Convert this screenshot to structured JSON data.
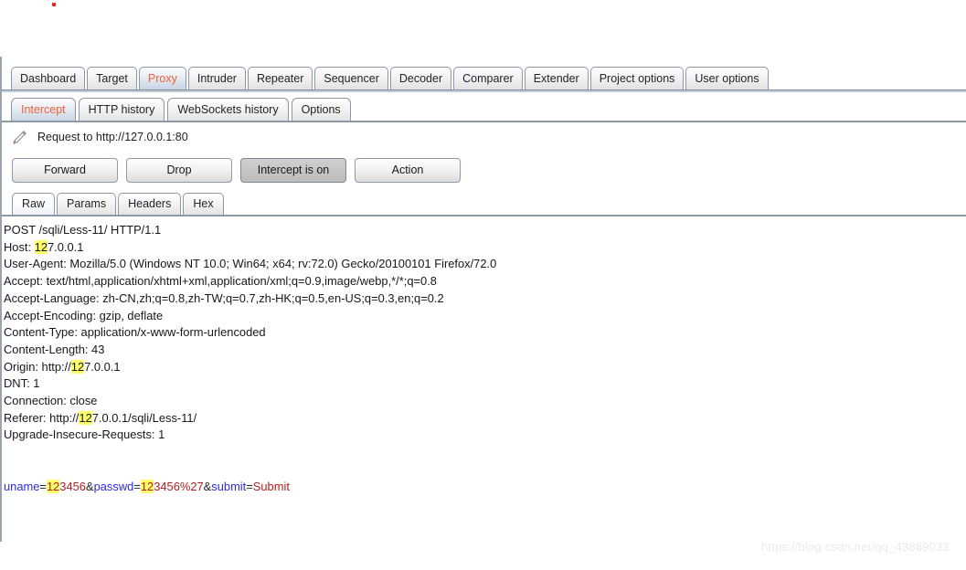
{
  "main_tabs": [
    {
      "label": "Dashboard",
      "selected": false
    },
    {
      "label": "Target",
      "selected": false
    },
    {
      "label": "Proxy",
      "selected": true
    },
    {
      "label": "Intruder",
      "selected": false
    },
    {
      "label": "Repeater",
      "selected": false
    },
    {
      "label": "Sequencer",
      "selected": false
    },
    {
      "label": "Decoder",
      "selected": false
    },
    {
      "label": "Comparer",
      "selected": false
    },
    {
      "label": "Extender",
      "selected": false
    },
    {
      "label": "Project options",
      "selected": false
    },
    {
      "label": "User options",
      "selected": false
    }
  ],
  "proxy_tabs": [
    {
      "label": "Intercept",
      "selected": true
    },
    {
      "label": "HTTP history",
      "selected": false
    },
    {
      "label": "WebSockets history",
      "selected": false
    },
    {
      "label": "Options",
      "selected": false
    }
  ],
  "intercept": {
    "edit_icon": "pencil-icon",
    "request_target": "Request to http://127.0.0.1:80",
    "buttons": [
      {
        "label": "Forward",
        "pressed": false
      },
      {
        "label": "Drop",
        "pressed": false
      },
      {
        "label": "Intercept is on",
        "pressed": true
      },
      {
        "label": "Action",
        "pressed": false
      }
    ]
  },
  "editor_tabs": [
    {
      "label": "Raw",
      "selected": true
    },
    {
      "label": "Params",
      "selected": false
    },
    {
      "label": "Headers",
      "selected": false
    },
    {
      "label": "Hex",
      "selected": false
    }
  ],
  "raw_request": {
    "request_line": "POST /sqli/Less-11/ HTTP/1.1",
    "headers": [
      {
        "name": "Host",
        "value": "127.0.0.1",
        "highlight": "12",
        "prefix": ""
      },
      {
        "name": "User-Agent",
        "value": "Mozilla/5.0 (Windows NT 10.0; Win64; x64; rv:72.0) Gecko/20100101 Firefox/72.0"
      },
      {
        "name": "Accept",
        "value": "text/html,application/xhtml+xml,application/xml;q=0.9,image/webp,*/*;q=0.8"
      },
      {
        "name": "Accept-Language",
        "value": "zh-CN,zh;q=0.8,zh-TW;q=0.7,zh-HK;q=0.5,en-US;q=0.3,en;q=0.2"
      },
      {
        "name": "Accept-Encoding",
        "value": "gzip, deflate"
      },
      {
        "name": "Content-Type",
        "value": "application/x-www-form-urlencoded"
      },
      {
        "name": "Content-Length",
        "value": "43"
      },
      {
        "name": "Origin",
        "value": "127.0.0.1",
        "highlight": "12",
        "prefix": "http://"
      },
      {
        "name": "DNT",
        "value": "1"
      },
      {
        "name": "Connection",
        "value": "close"
      },
      {
        "name": "Referer",
        "value": "127.0.0.1/sqli/Less-11/",
        "highlight": "12",
        "prefix": "http://"
      },
      {
        "name": "Upgrade-Insecure-Requests",
        "value": "1"
      }
    ],
    "body_params": [
      {
        "name": "uname",
        "highlight": "12",
        "value_rest": "3456",
        "separator": "&"
      },
      {
        "name": "passwd",
        "highlight": "12",
        "value_rest": "3456%27",
        "separator": "&"
      },
      {
        "name": "submit",
        "highlight": "",
        "value_rest": "Submit",
        "separator": ""
      }
    ]
  },
  "watermark": "https://blog.csdn.net/qq_43869033",
  "colors": {
    "selected_tab_text": "#f0613c",
    "highlight": "#ffff6b",
    "param_name": "#2c2cdd",
    "param_value": "#b02020"
  }
}
